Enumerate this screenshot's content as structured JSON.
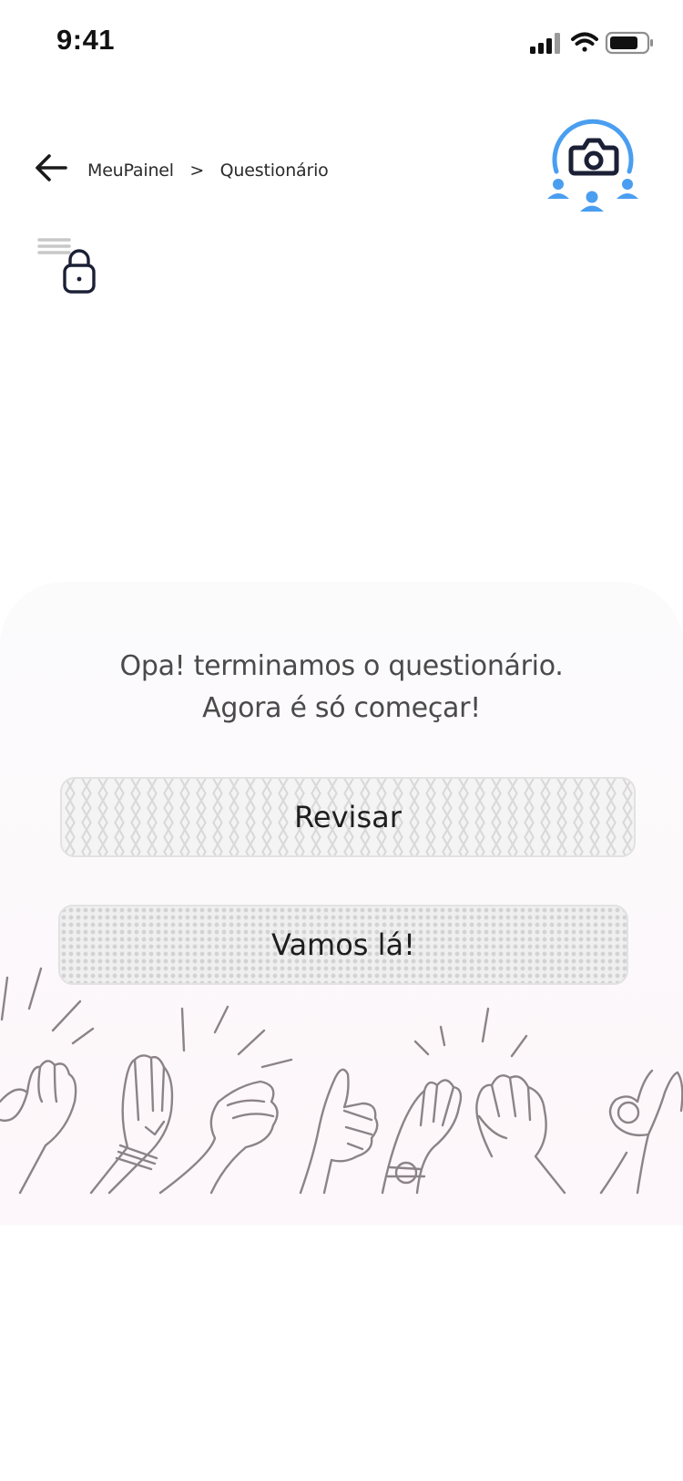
{
  "status_bar": {
    "time": "9:41",
    "icons": [
      "signal-icon",
      "wifi-icon",
      "battery-icon"
    ]
  },
  "header": {
    "back_icon": "arrow-left-icon",
    "breadcrumb": {
      "home": "MeuPainel",
      "separator": ">",
      "current": "Questionário"
    },
    "profile_icon": "camera-group-icon"
  },
  "menu": {
    "icon": "lock-menu-icon"
  },
  "completion": {
    "line1": "Opa! terminamos o questionário.",
    "line2": "Agora é só começar!",
    "review_label": "Revisar",
    "start_label": "Vamos lá!"
  },
  "illustration": {
    "icon": "clapping-hands-illustration"
  },
  "colors": {
    "accent": "#4a9ef0",
    "icon_dark": "#1b2036",
    "panel_bg": "#fcf8fa",
    "line_art": "#8c8387"
  }
}
